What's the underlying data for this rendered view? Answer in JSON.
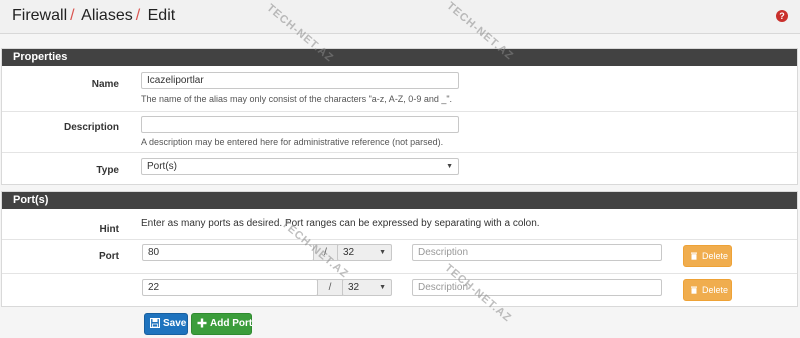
{
  "breadcrumb": [
    "Firewall",
    "Aliases",
    "Edit"
  ],
  "breadcrumb_separator": "/",
  "help_icon": "question-circle-icon",
  "properties": {
    "heading": "Properties",
    "name_label": "Name",
    "name_value": "Icazeliportlar",
    "name_help": "The name of the alias may only consist of the characters \"a-z, A-Z, 0-9 and _\".",
    "description_label": "Description",
    "description_value": "",
    "description_help": "A description may be entered here for administrative reference (not parsed).",
    "type_label": "Type",
    "type_value": "Port(s)"
  },
  "ports": {
    "heading": "Port(s)",
    "hint_label": "Hint",
    "hint_text": "Enter as many ports as desired. Port ranges can be expressed by separating with a colon.",
    "port_label": "Port",
    "rows": [
      {
        "port": "80",
        "sep": "/",
        "mask": "32",
        "description_placeholder": "Description",
        "delete_label": "Delete"
      },
      {
        "port": "22",
        "sep": "/",
        "mask": "32",
        "description_placeholder": "Description",
        "delete_label": "Delete"
      }
    ]
  },
  "buttons": {
    "save": "Save",
    "add_port": "Add Port"
  },
  "watermark": "TECH-NET.AZ",
  "colors": {
    "heading_bg": "#424242",
    "breadcrumb_sep": "#d9534f",
    "delete": "#f0ad4e",
    "save": "#1e73be",
    "add": "#3b9d3b",
    "help_icon": "#c9302c"
  }
}
